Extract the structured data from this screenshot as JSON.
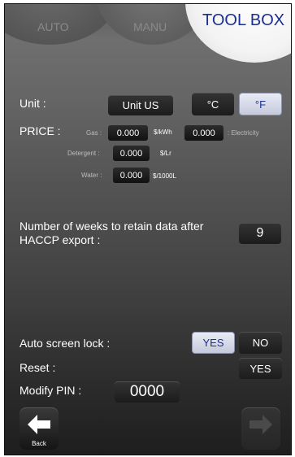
{
  "tabs": {
    "auto": "AUTO",
    "manu": "MANU",
    "toolbox": "TOOL BOX"
  },
  "unit": {
    "label": "Unit :",
    "system_button": "Unit US",
    "celsius": "°C",
    "fahrenheit": "°F",
    "selected_temperature": "°F"
  },
  "price": {
    "label": "PRICE :",
    "gas_label": "Gas :",
    "gas_value": "0.000",
    "gas_unit": "$/kWh",
    "electricity_value": "0.000",
    "electricity_label": ": Electricity",
    "detergent_label": "Detergent :",
    "detergent_value": "0.000",
    "detergent_unit": "$/Lr",
    "water_label": "Water :",
    "water_value": "0.000",
    "water_unit": "$/1000L"
  },
  "retention": {
    "label_line1": "Number of weeks to retain data after",
    "label_line2": "HACCP export :",
    "value": "9"
  },
  "auto_lock": {
    "label": "Auto screen lock :",
    "yes": "YES",
    "no": "NO",
    "selected": "YES"
  },
  "reset": {
    "label": "Reset :",
    "yes": "YES"
  },
  "pin": {
    "label": "Modify PIN :",
    "value": "0000"
  },
  "nav": {
    "back_label": "Back"
  },
  "colors": {
    "accent_text": "#1b2f8f",
    "active_button": "#d6dae8"
  }
}
